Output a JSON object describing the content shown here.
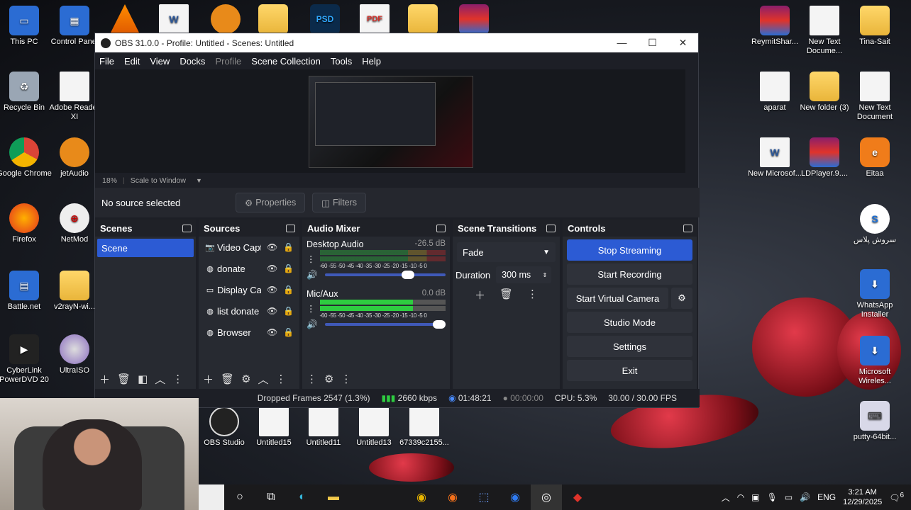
{
  "desktop": {
    "left_icons": [
      {
        "label": "This PC"
      },
      {
        "label": "Control Panel"
      },
      {
        "label": "Recycle Bin"
      },
      {
        "label": "Adobe Reader XI"
      },
      {
        "label": "Google Chrome"
      },
      {
        "label": "jetAudio"
      },
      {
        "label": "Firefox"
      },
      {
        "label": "NetMod"
      },
      {
        "label": "Battle.net"
      },
      {
        "label": "v2rayN-wi..."
      },
      {
        "label": "CyberLink PowerDVD 20"
      },
      {
        "label": "UltraISO"
      }
    ],
    "top_icons": [
      {
        "label": "PSD"
      },
      {
        "label": "PDF"
      }
    ],
    "right_icons": [
      {
        "label": "ReymitShar..."
      },
      {
        "label": "New Text Docume..."
      },
      {
        "label": "Tina-Sait"
      },
      {
        "label": "aparat"
      },
      {
        "label": "New folder (3)"
      },
      {
        "label": "New Text Document"
      },
      {
        "label": "New Microsof..."
      },
      {
        "label": "LDPlayer.9...."
      },
      {
        "label": "Eitaa"
      },
      {
        "label": "سروش پلاس"
      },
      {
        "label": "WhatsApp Installer"
      },
      {
        "label": "Microsoft Wireles..."
      },
      {
        "label": "putty-64bit..."
      }
    ],
    "bottom_icons": [
      {
        "label": "OBS Studio"
      },
      {
        "label": "Untitled15"
      },
      {
        "label": "Untitled11"
      },
      {
        "label": "Untitled13"
      },
      {
        "label": "67339c2155..."
      }
    ]
  },
  "obs": {
    "title": "OBS 31.0.0 - Profile: Untitled - Scenes: Untitled",
    "menu": [
      "File",
      "Edit",
      "View",
      "Docks",
      "Profile",
      "Scene Collection",
      "Tools",
      "Help"
    ],
    "zoom": "18%",
    "scale_mode": "Scale to Window",
    "no_source": "No source selected",
    "properties": "Properties",
    "filters": "Filters",
    "scenes": {
      "title": "Scenes",
      "items": [
        "Scene"
      ]
    },
    "sources": {
      "title": "Sources",
      "items": [
        {
          "name": "Video Capture Device",
          "icon": "camera-icon"
        },
        {
          "name": "donate",
          "icon": "globe-icon"
        },
        {
          "name": "Display Capture",
          "icon": "monitor-icon"
        },
        {
          "name": "list donate",
          "icon": "globe-icon"
        },
        {
          "name": "Browser",
          "icon": "globe-icon"
        }
      ]
    },
    "audio": {
      "title": "Audio Mixer",
      "scale": "-60 -55 -50 -45 -40 -35 -30 -25 -20 -15 -10 -5 0",
      "channels": [
        {
          "name": "Desktop Audio",
          "db": "-26.5 dB",
          "volume": 0.74
        },
        {
          "name": "Mic/Aux",
          "db": "0.0 dB",
          "volume": 1.0
        }
      ]
    },
    "transitions": {
      "title": "Scene Transitions",
      "selected": "Fade",
      "duration_label": "Duration",
      "duration_value": "300 ms"
    },
    "controls": {
      "title": "Controls",
      "stop_streaming": "Stop Streaming",
      "start_recording": "Start Recording",
      "start_virtual_camera": "Start Virtual Camera",
      "studio_mode": "Studio Mode",
      "settings": "Settings",
      "exit": "Exit"
    },
    "status": {
      "dropped": "Dropped Frames 2547 (1.3%)",
      "bitrate": "2660 kbps",
      "stream_time": "01:48:21",
      "rec_time": "00:00:00",
      "cpu": "CPU: 5.3%",
      "fps": "30.00 / 30.00 FPS"
    }
  },
  "taskbar": {
    "language": "ENG",
    "time": "3:21 AM",
    "date": "12/29/2025",
    "notifications": "6"
  }
}
